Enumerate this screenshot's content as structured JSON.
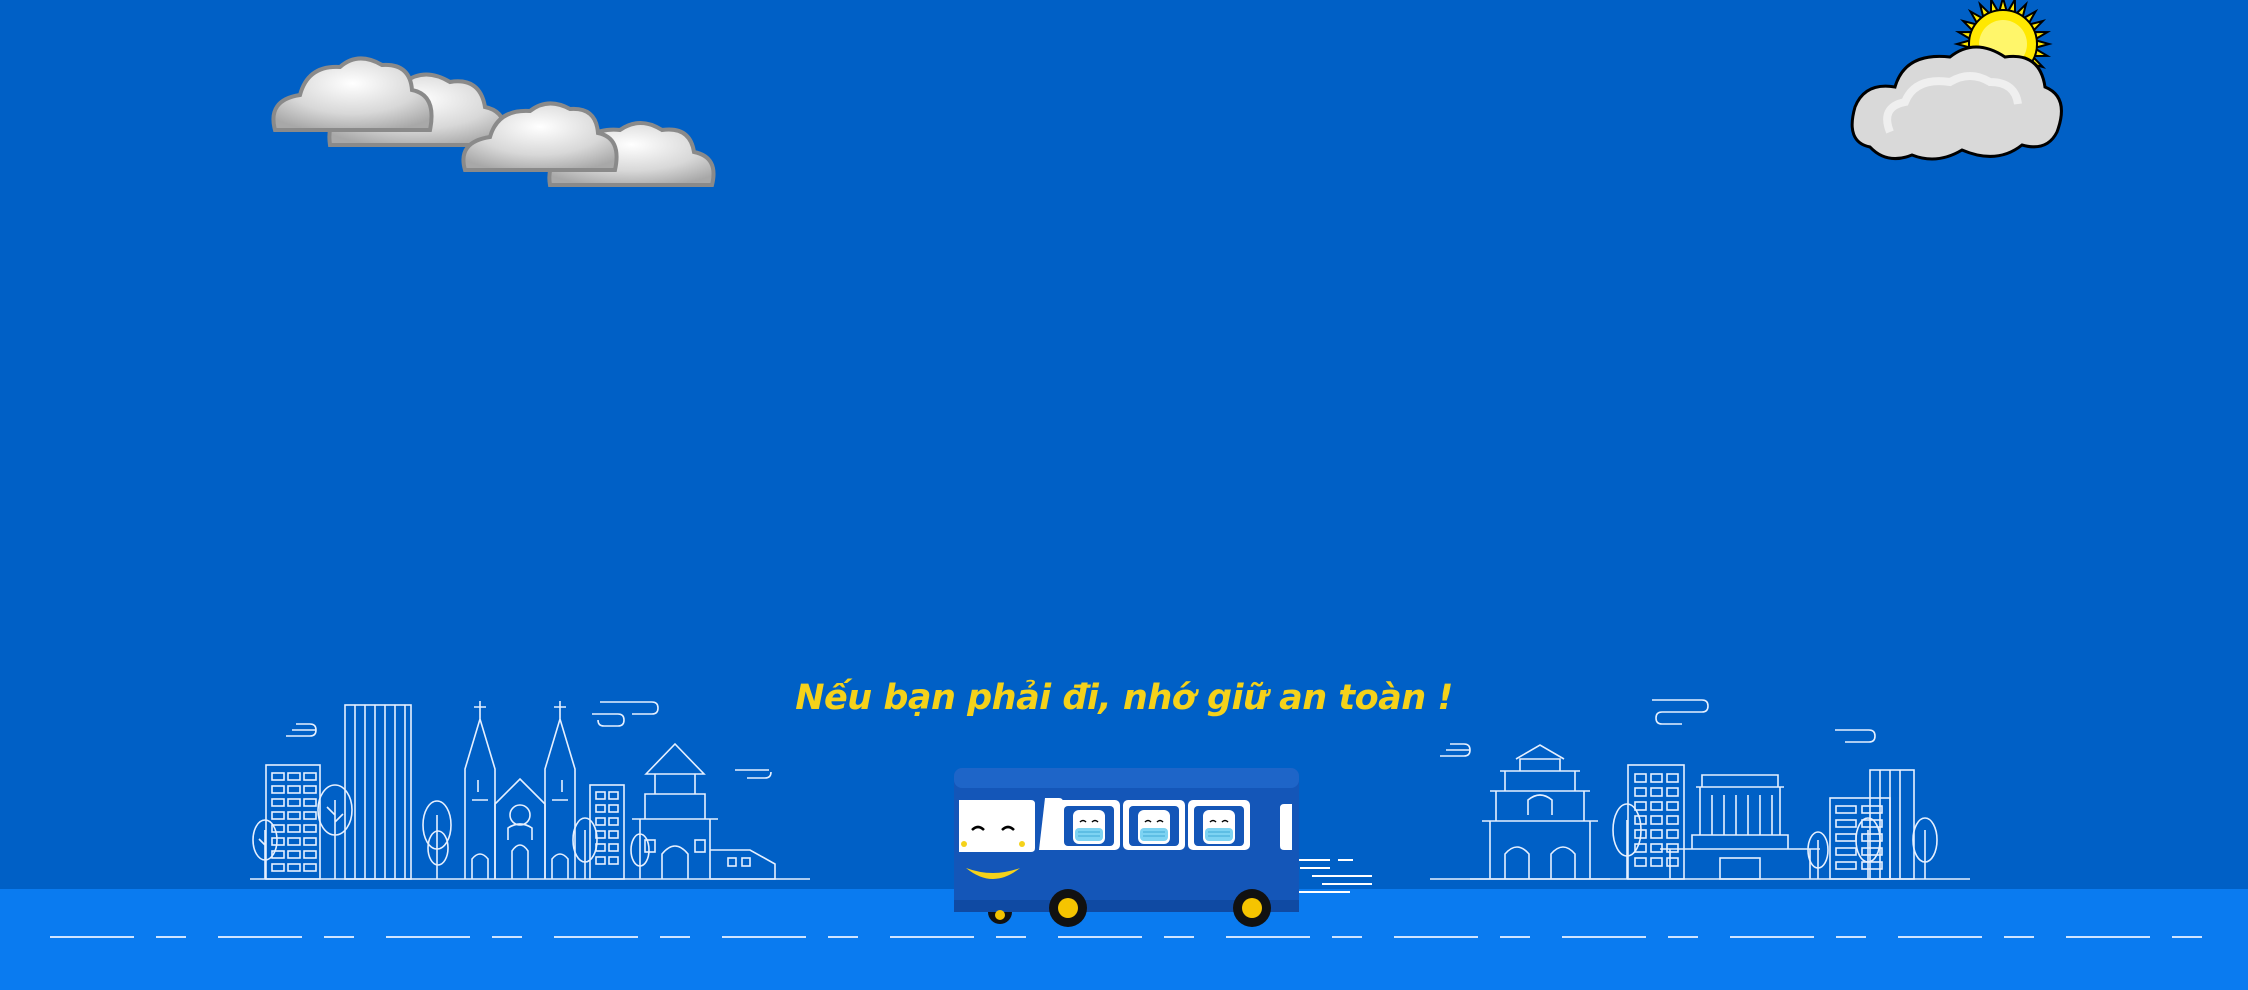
{
  "tagline": "Nếu bạn phải đi, nhớ giữ an toàn !",
  "colors": {
    "sky": "#0060C6",
    "road": "#0A7BF0",
    "accent_text": "#F5D21A",
    "bus_body": "#1456B8",
    "line_art": "#FFFFFF",
    "sun": "#FFE800"
  },
  "icons": [
    "cloud-icon",
    "sun-behind-cloud-icon",
    "bus-icon",
    "city-skyline-left",
    "city-skyline-right"
  ]
}
